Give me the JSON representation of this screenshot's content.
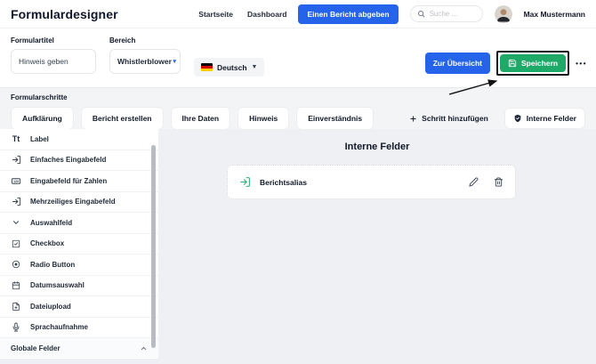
{
  "header": {
    "title": "Formulardesigner",
    "nav": [
      {
        "label": "Startseite"
      },
      {
        "label": "Dashboard"
      }
    ],
    "report_button_label": "Einen Bericht abgeben",
    "search_placeholder": "Suche ...",
    "user_name": "Max Mustermann"
  },
  "toolbar": {
    "form_title_label": "Formulartitel",
    "form_title_value": "Hinweis geben",
    "area_label": "Bereich",
    "area_value": "Whistlerblower",
    "language_value": "Deutsch",
    "overview_button_label": "Zur Übersicht",
    "save_button_label": "Speichern",
    "more_label": "•••"
  },
  "steps": {
    "section_label": "Formularschritte",
    "items": [
      {
        "label": "Aufklärung"
      },
      {
        "label": "Bericht erstellen"
      },
      {
        "label": "Ihre Daten"
      },
      {
        "label": "Hinweis"
      },
      {
        "label": "Einverständnis"
      }
    ],
    "add_step_label": "Schritt hinzufügen",
    "internal_fields_label": "Interne Felder"
  },
  "sidebar": {
    "items": [
      {
        "label": "Label",
        "icon": "text-label-icon"
      },
      {
        "label": "Einfaches Eingabefeld",
        "icon": "input-icon"
      },
      {
        "label": "Eingabefeld für Zahlen",
        "icon": "number-input-icon"
      },
      {
        "label": "Mehrzeiliges Eingabefeld",
        "icon": "textarea-icon"
      },
      {
        "label": "Auswahlfeld",
        "icon": "chevron-down-icon"
      },
      {
        "label": "Checkbox",
        "icon": "checkbox-icon"
      },
      {
        "label": "Radio Button",
        "icon": "radio-icon"
      },
      {
        "label": "Datumsauswahl",
        "icon": "calendar-icon"
      },
      {
        "label": "Dateiupload",
        "icon": "file-upload-icon"
      },
      {
        "label": "Sprachaufnahme",
        "icon": "microphone-icon"
      }
    ],
    "footer_label": "Globale Felder"
  },
  "main": {
    "heading": "Interne Felder",
    "card": {
      "label": "Berichtsalias"
    }
  },
  "colors": {
    "primary_blue": "#2563eb",
    "success_green": "#1fa968",
    "annotation_black": "#111111",
    "flag_black": "#000000",
    "flag_red": "#dd0000",
    "flag_gold": "#ffce00"
  }
}
